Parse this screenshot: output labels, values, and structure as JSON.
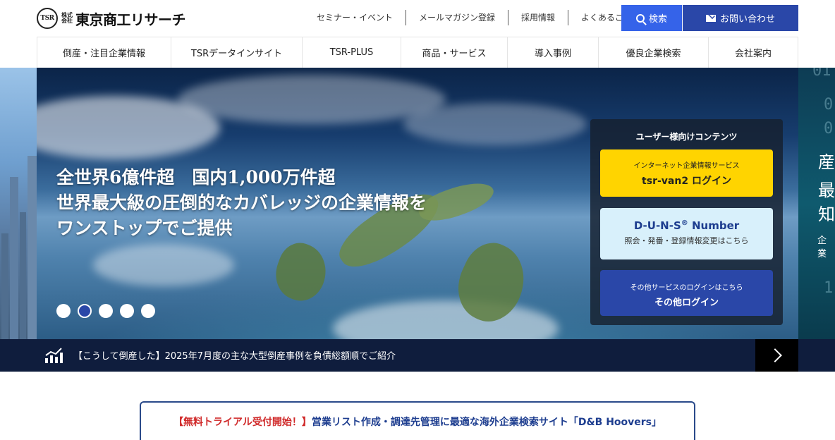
{
  "header": {
    "logo": {
      "mark": "TSR",
      "kabushiki": "株式会社",
      "name": "東京商工リサーチ"
    },
    "util_links": [
      "セミナー・イベント",
      "メールマガジン登録",
      "採用情報",
      "よくあるご質問"
    ],
    "search_label": "検索",
    "contact_label": "お問い合わせ",
    "search_color": "#3563e9",
    "contact_color": "#2a47a8"
  },
  "nav": {
    "items": [
      {
        "label": "倒産・注目企業情報"
      },
      {
        "label": "TSRデータインサイト"
      },
      {
        "label": "TSR-PLUS"
      },
      {
        "label": "商品・サービス"
      },
      {
        "label": "導入事例"
      },
      {
        "label": "優良企業検索"
      },
      {
        "label": "会社案内"
      }
    ]
  },
  "hero": {
    "lines": [
      "全世界6億件超　国内1,000万件超",
      "世界最大級の圧倒的なカバレッジの企業情報を",
      "ワンストップでご提供"
    ],
    "slide_count": 5,
    "active_slide": 2,
    "right_peek": {
      "chars": [
        "産",
        "最",
        "知"
      ],
      "small": "企業"
    }
  },
  "login_panel": {
    "title": "ユーザー様向けコンテンツ",
    "tsr_van2": {
      "sub": "インターネット企業情報サービス",
      "main": "tsr-van2 ログイン",
      "color": "#ffd400"
    },
    "duns": {
      "main": "D-U-N-S",
      "reg": "®",
      "main_suffix": " Number",
      "sub": "照会・発番・登録情報変更はこちら",
      "color": "#d8f0fb"
    },
    "other": {
      "sub": "その他サービスのログインはこちら",
      "main": "その他ログイン",
      "color": "#2a47a8"
    }
  },
  "news": {
    "icon": "chart-icon",
    "text": "【こうして倒産した】2025年7月度の主な大型倒産事例を負債総額順でご紹介"
  },
  "banner": {
    "highlight": "【無料トライアル受付開始！】",
    "text": "営業リスト作成・調達先管理に最適な海外企業検索サイト「D&B Hoovers」"
  }
}
